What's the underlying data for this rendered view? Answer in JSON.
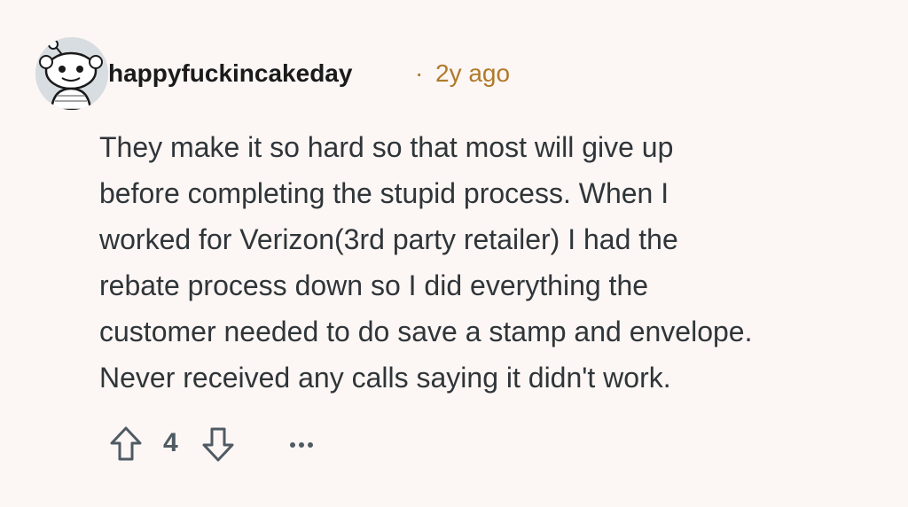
{
  "comment": {
    "author": "happyfuckincakeday",
    "separator": "·",
    "timestamp": "2y ago",
    "body_lines": [
      "They make it so hard so that most will give up",
      "before completing the stupid process. When I",
      "worked for Verizon(3rd party retailer) I had the",
      "rebate process down so I did everything the",
      "customer needed to do save a stamp and envelope.",
      "Never received any calls saying it didn't work."
    ],
    "vote_count": "4",
    "icons": {
      "avatar": "snoo-avatar-icon",
      "upvote": "arrow-up-icon",
      "downvote": "arrow-down-icon",
      "more": "ellipsis-icon"
    },
    "colors": {
      "background": "#fcf6f4",
      "timestamp": "#b07a2a",
      "text": "#2f3539",
      "icon": "#4f5b63"
    }
  }
}
